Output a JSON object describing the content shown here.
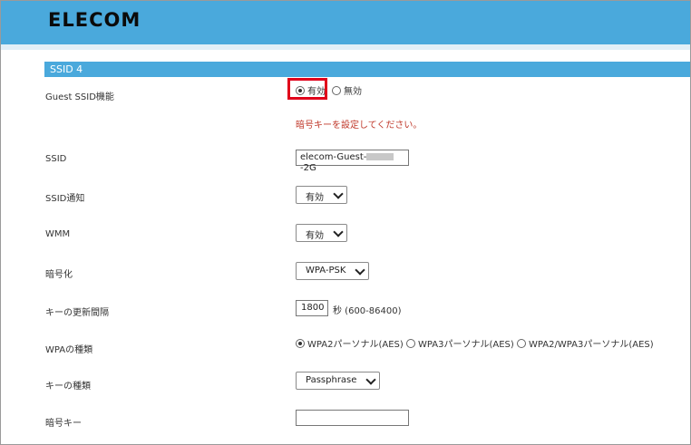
{
  "brand": {
    "logo_text": "ELECOM"
  },
  "section": {
    "title": "SSID 4"
  },
  "guest": {
    "label": "Guest SSID機能",
    "options": [
      {
        "label": "有効",
        "checked": true
      },
      {
        "label": "無効",
        "checked": false
      }
    ]
  },
  "error_message": "暗号キーを設定してください。",
  "ssid": {
    "label": "SSID",
    "value_prefix": "elecom-Guest-",
    "value_suffix": "-2G"
  },
  "ssid_broadcast": {
    "label": "SSID通知",
    "selected": "有効"
  },
  "wmm": {
    "label": "WMM",
    "selected": "有効"
  },
  "encryption": {
    "label": "暗号化",
    "selected": "WPA-PSK"
  },
  "rekey": {
    "label": "キーの更新間隔",
    "value": "1800",
    "unit": "秒 (600-86400)"
  },
  "wpa_type": {
    "label": "WPAの種類",
    "options": [
      {
        "label": "WPA2パーソナル(AES)",
        "checked": true
      },
      {
        "label": "WPA3パーソナル(AES)",
        "checked": false
      },
      {
        "label": "WPA2/WPA3パーソナル(AES)",
        "checked": false
      }
    ]
  },
  "key_type": {
    "label": "キーの種類",
    "selected": "Passphrase"
  },
  "passkey": {
    "label": "暗号キー",
    "value": ""
  },
  "colors": {
    "header": "#4aa9dc",
    "highlight": "#e0001a",
    "error": "#c0392b"
  }
}
